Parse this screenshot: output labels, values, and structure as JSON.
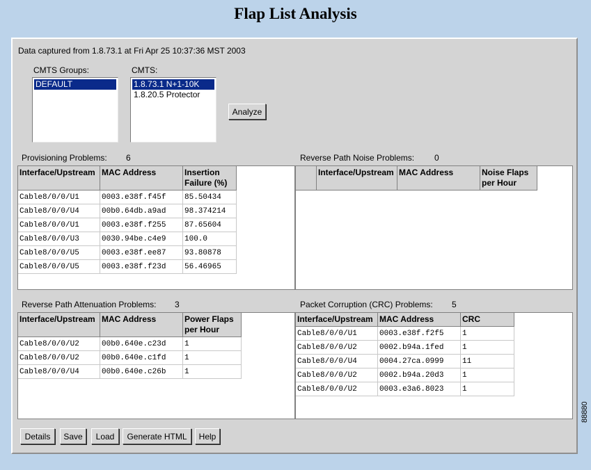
{
  "page_title": "Flap List Analysis",
  "capture_text": "Data captured from 1.8.73.1 at Fri Apr 25 10:37:36 MST 2003",
  "cmts_groups": {
    "label": "CMTS Groups:",
    "options": [
      "DEFAULT"
    ],
    "selected": "DEFAULT"
  },
  "cmts": {
    "label": "CMTS:",
    "options": [
      "1.8.73.1 N+1-10K",
      "1.8.20.5 Protector"
    ],
    "selected": "1.8.73.1 N+1-10K"
  },
  "analyze_label": "Analyze",
  "provisioning": {
    "label": "Provisioning Problems:",
    "count": "6",
    "headers": [
      "Interface/Upstream",
      "MAC Address",
      "Insertion\nFailure (%)"
    ],
    "rows": [
      [
        "Cable8/0/0/U1",
        "0003.e38f.f45f",
        "85.50434"
      ],
      [
        "Cable8/0/0/U4",
        "00b0.64db.a9ad",
        "98.374214"
      ],
      [
        "Cable8/0/0/U1",
        "0003.e38f.f255",
        "87.65604"
      ],
      [
        "Cable8/0/0/U3",
        "0030.94be.c4e9",
        "100.0"
      ],
      [
        "Cable8/0/0/U5",
        "0003.e38f.ee87",
        "93.80878"
      ],
      [
        "Cable8/0/0/U5",
        "0003.e38f.f23d",
        "56.46965"
      ]
    ]
  },
  "noise": {
    "label": "Reverse Path Noise Problems:",
    "count": "0",
    "headers": [
      "",
      "Interface/Upstream",
      "MAC Address",
      "Noise Flaps\nper Hour"
    ],
    "rows": []
  },
  "attenuation": {
    "label": "Reverse Path Attenuation Problems:",
    "count": "3",
    "headers": [
      "Interface/Upstream",
      "MAC Address",
      "Power Flaps\nper Hour"
    ],
    "rows": [
      [
        "Cable8/0/0/U2",
        "00b0.640e.c23d",
        "1"
      ],
      [
        "Cable8/0/0/U2",
        "00b0.640e.c1fd",
        "1"
      ],
      [
        "Cable8/0/0/U4",
        "00b0.640e.c26b",
        "1"
      ]
    ]
  },
  "crc": {
    "label": "Packet Corruption (CRC) Problems:",
    "count": "5",
    "headers": [
      "Interface/Upstream",
      "MAC Address",
      "CRC"
    ],
    "rows": [
      [
        "Cable8/0/0/U1",
        "0003.e38f.f2f5",
        "1"
      ],
      [
        "Cable8/0/0/U2",
        "0002.b94a.1fed",
        "1"
      ],
      [
        "Cable8/0/0/U4",
        "0004.27ca.0999",
        "11"
      ],
      [
        "Cable8/0/0/U2",
        "0002.b94a.20d3",
        "1"
      ],
      [
        "Cable8/0/0/U2",
        "0003.e3a6.8023",
        "1"
      ]
    ]
  },
  "buttons": {
    "details": "Details",
    "save": "Save",
    "load": "Load",
    "generate_html": "Generate HTML",
    "help": "Help"
  },
  "figure_code": "88880"
}
